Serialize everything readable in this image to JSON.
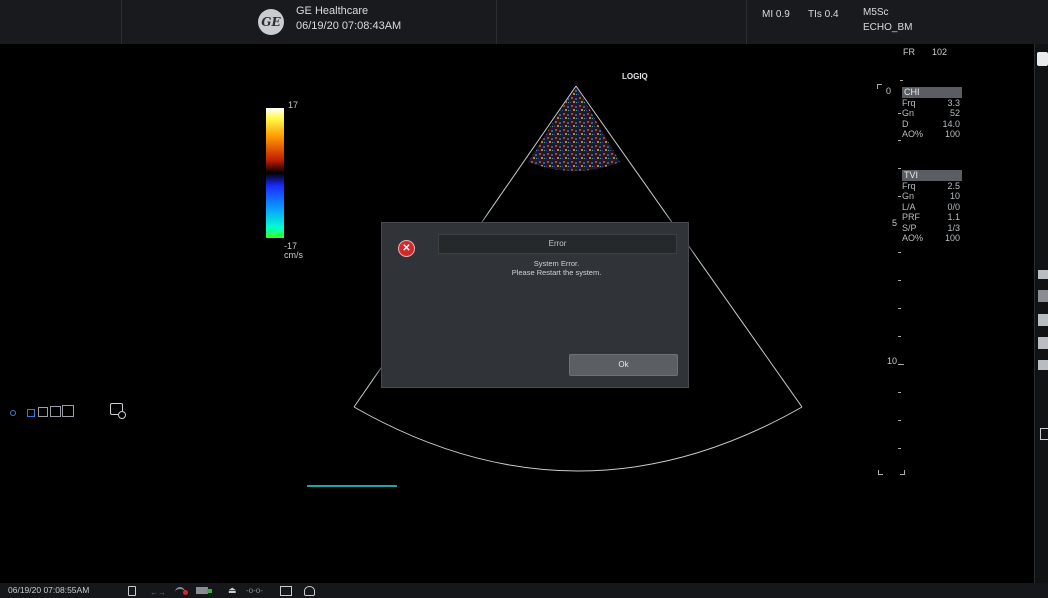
{
  "header": {
    "company": "GE Healthcare",
    "datetime": "06/19/20 07:08:43AM",
    "mi": "MI 0.9",
    "tis": "TIs 0.4",
    "probe": "M5Sc",
    "preset": "ECHO_BM",
    "logo_text": "GE"
  },
  "image": {
    "brand": "LOGIQ",
    "fr_label": "FR",
    "fr_value": "102",
    "colorbar_max": "17",
    "colorbar_min": "-17",
    "colorbar_unit": "cm/s",
    "depth_marks": [
      "0",
      "5",
      "10"
    ],
    "chi": {
      "title": "CHI",
      "rows": [
        {
          "k": "Frq",
          "v": "3.3"
        },
        {
          "k": "Gn",
          "v": "52"
        },
        {
          "k": "D",
          "v": "14.0"
        },
        {
          "k": "AO%",
          "v": "100"
        }
      ]
    },
    "tvi": {
      "title": "TVI",
      "rows": [
        {
          "k": "Frq",
          "v": "2.5"
        },
        {
          "k": "Gn",
          "v": "10"
        },
        {
          "k": "L/A",
          "v": "0/0"
        },
        {
          "k": "PRF",
          "v": "1.1"
        },
        {
          "k": "S/P",
          "v": "1/3"
        },
        {
          "k": "AO%",
          "v": "100"
        }
      ]
    }
  },
  "dialog": {
    "title": "Error",
    "message_line1": "System Error.",
    "message_line2": "Please Restart the system.",
    "ok_label": "Ok"
  },
  "footer": {
    "datetime": "06/19/20 07:08:55AM"
  },
  "colors": {
    "background": "#000000",
    "dialog_bg": "#303337",
    "error_red": "#d12a2a",
    "trace_teal": "#1aa9a0"
  }
}
